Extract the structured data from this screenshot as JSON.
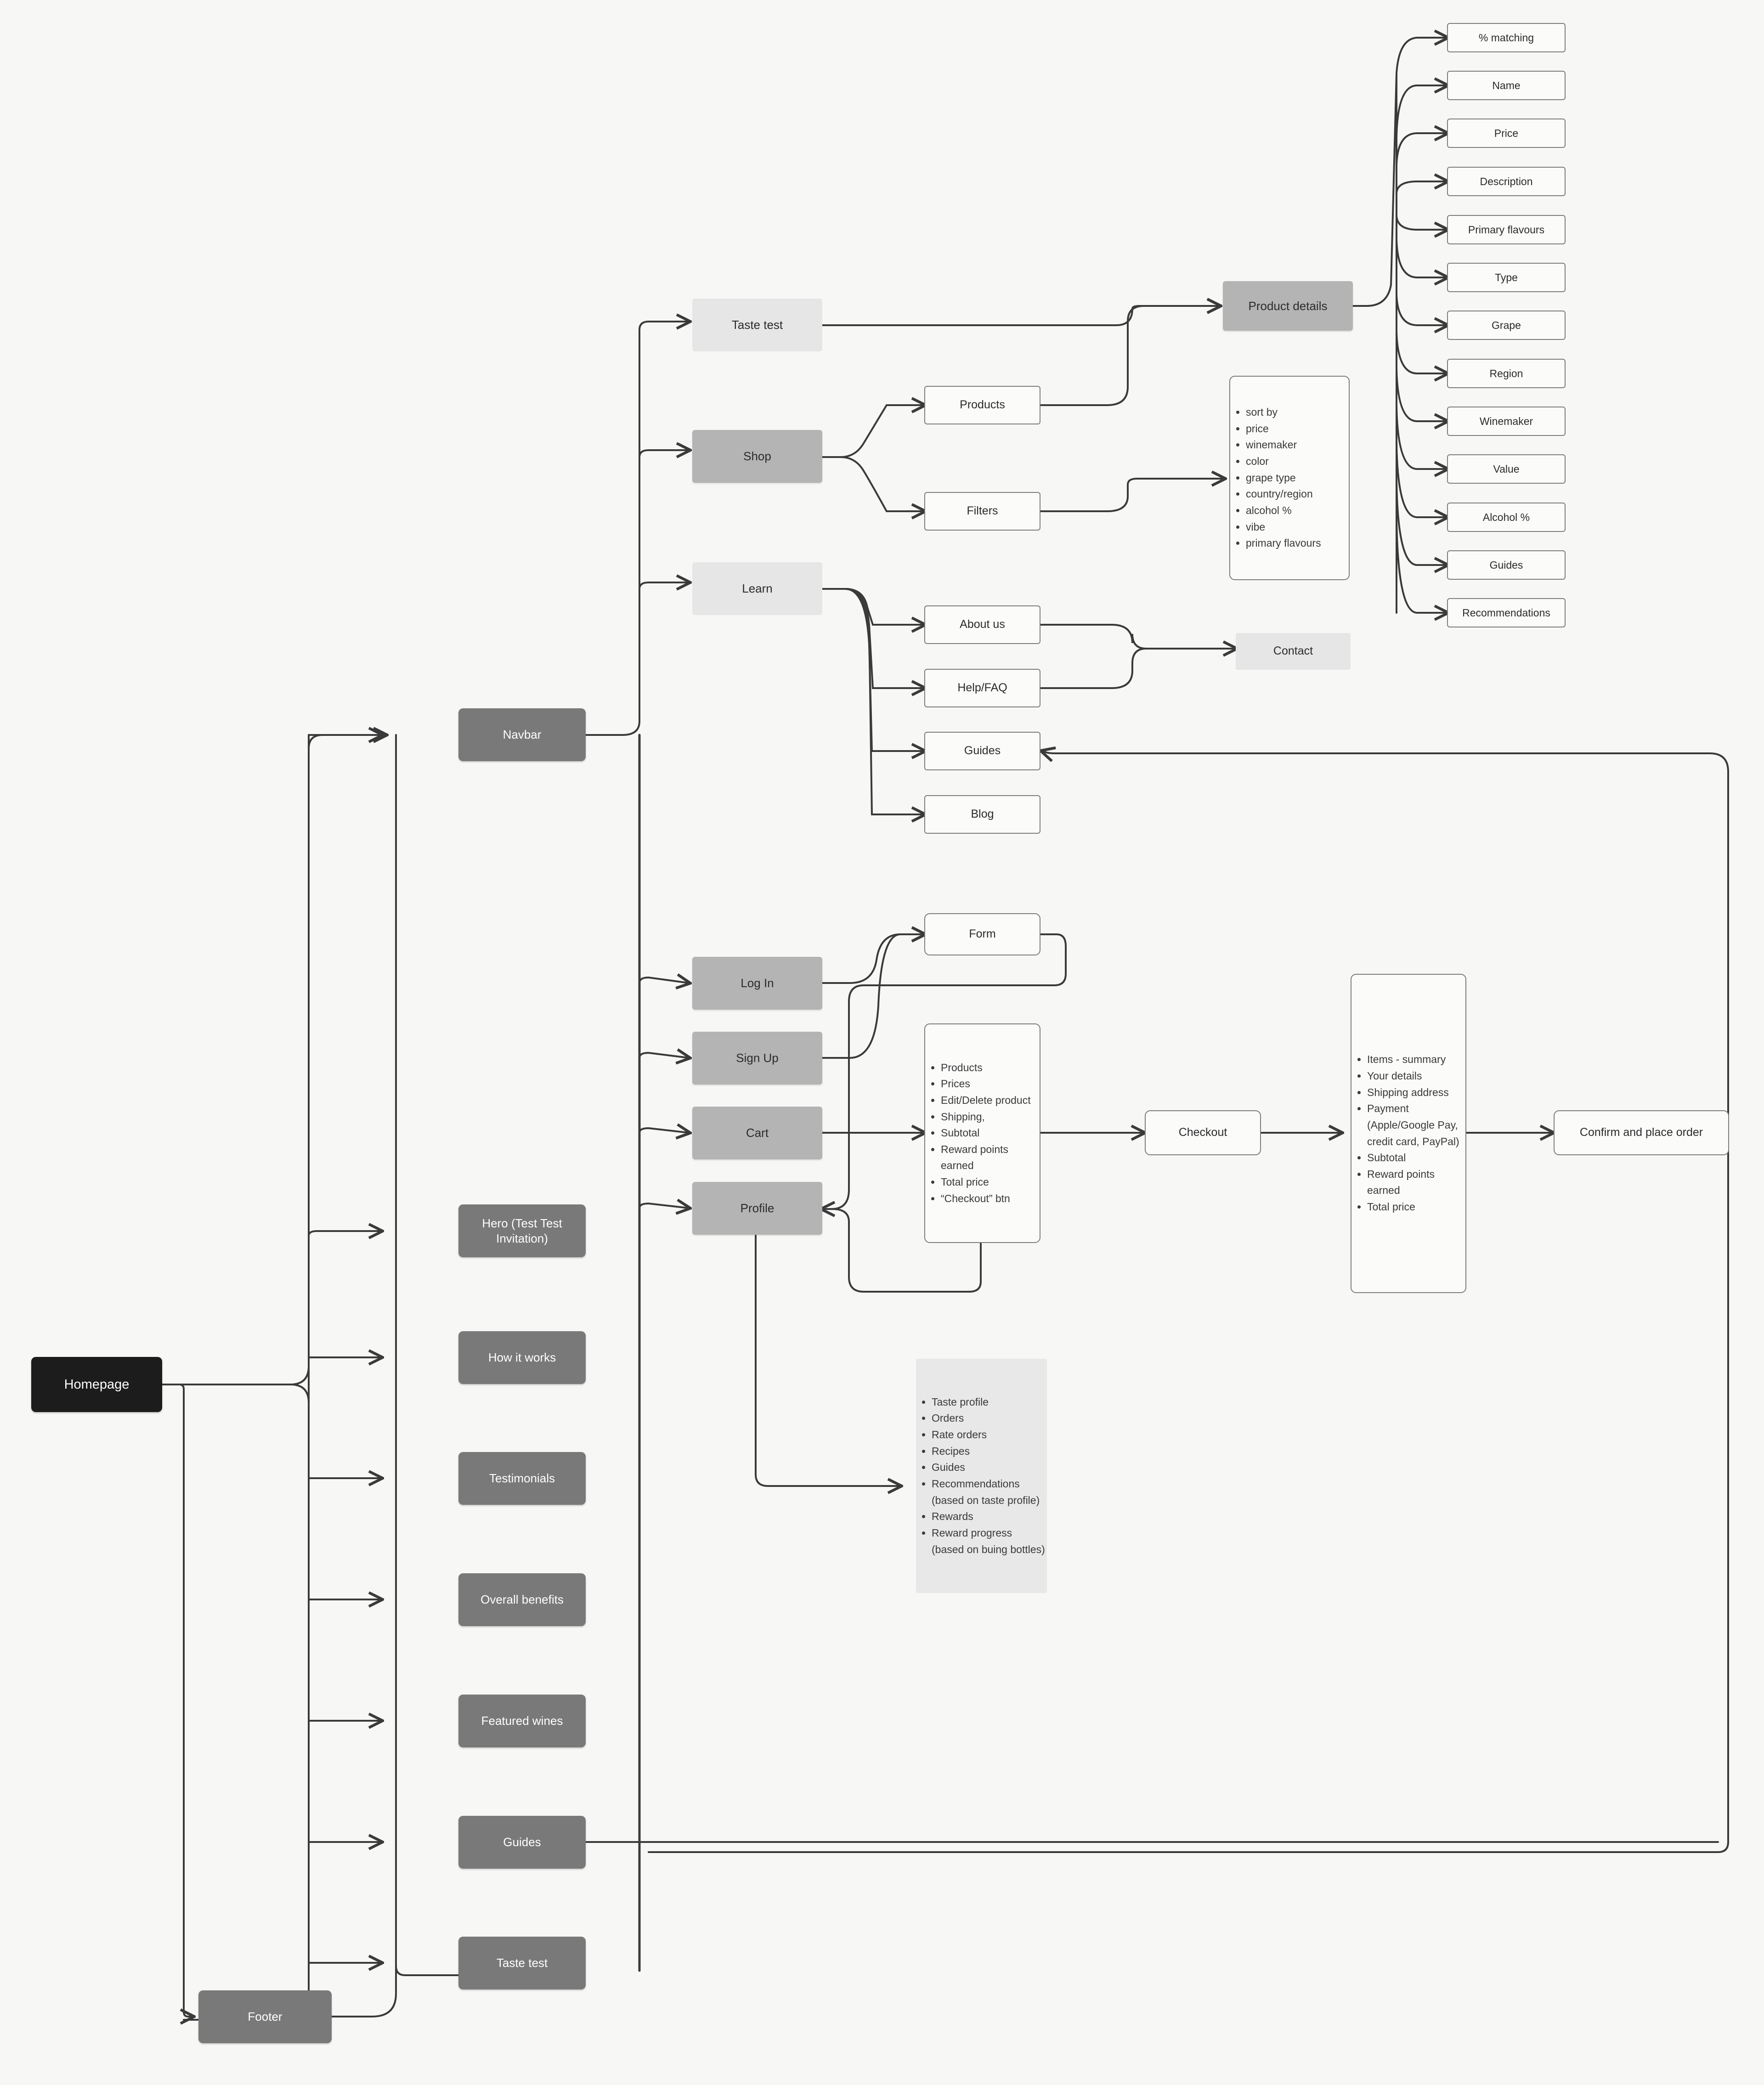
{
  "diagram": {
    "title": "Wine e-commerce site map / user flow",
    "colors": {
      "background": "#f7f7f5",
      "root_node": "#1c1c1c",
      "dark_node": "#797979",
      "mid_node": "#b4b4b4",
      "light_node": "#e6e6e6",
      "outline_node": "#fbfbfa",
      "border": "#7d7d7d",
      "edge": "#3a3a3a"
    }
  },
  "nodes": {
    "homepage": {
      "label": "Homepage"
    },
    "navbar": {
      "label": "Navbar"
    },
    "hero": {
      "label": "Hero (Test Test\nInvitation)"
    },
    "how_it_works": {
      "label": "How it works"
    },
    "testimonials": {
      "label": "Testimonials"
    },
    "overall_benefits": {
      "label": "Overall benefits"
    },
    "featured_wines": {
      "label": "Featured wines"
    },
    "guides_home": {
      "label": "Guides"
    },
    "taste_test_home": {
      "label": "Taste test"
    },
    "footer": {
      "label": "Footer"
    },
    "taste_test_nav": {
      "label": "Taste test"
    },
    "shop": {
      "label": "Shop"
    },
    "learn": {
      "label": "Learn"
    },
    "log_in": {
      "label": "Log In"
    },
    "sign_up": {
      "label": "Sign Up"
    },
    "cart": {
      "label": "Cart"
    },
    "profile": {
      "label": "Profile"
    },
    "products": {
      "label": "Products"
    },
    "filters": {
      "label": "Filters"
    },
    "about_us": {
      "label": "About us"
    },
    "help_faq": {
      "label": "Help/FAQ"
    },
    "guides_learn": {
      "label": "Guides"
    },
    "blog": {
      "label": "Blog"
    },
    "form": {
      "label": "Form"
    },
    "product_details": {
      "label": "Product details"
    },
    "contact": {
      "label": "Contact"
    },
    "checkout": {
      "label": "Checkout"
    },
    "confirm_order": {
      "label": "Confirm and place order"
    }
  },
  "product_attributes": [
    {
      "label": "% matching"
    },
    {
      "label": "Name"
    },
    {
      "label": "Price"
    },
    {
      "label": "Description"
    },
    {
      "label": "Primary flavours"
    },
    {
      "label": "Type"
    },
    {
      "label": "Grape"
    },
    {
      "label": "Region"
    },
    {
      "label": "Winemaker"
    },
    {
      "label": "Value"
    },
    {
      "label": "Alcohol %"
    },
    {
      "label": "Guides"
    },
    {
      "label": "Recommendations"
    }
  ],
  "filters_list": {
    "items": [
      "sort by",
      "price",
      "winemaker",
      "color",
      "grape type",
      "country/region",
      "alcohol %",
      "vibe",
      "primary flavours"
    ]
  },
  "cart_list": {
    "items": [
      "Products",
      "Prices",
      "Edit/Delete product",
      "Shipping,",
      "Subtotal",
      "Reward points earned",
      "Total price",
      "“Checkout” btn"
    ]
  },
  "checkout_list": {
    "items": [
      "Items - summary",
      "Your details",
      "Shipping address",
      "Payment (Apple/Google Pay, credit card, PayPal)",
      "Subtotal",
      "Reward points earned",
      "Total price"
    ]
  },
  "profile_list": {
    "items": [
      "Taste profile",
      "Orders",
      "Rate orders",
      "Recipes",
      "Guides",
      "Recommendations (based on taste profile)",
      "Rewards",
      "Reward progress (based on buing bottles)"
    ]
  }
}
